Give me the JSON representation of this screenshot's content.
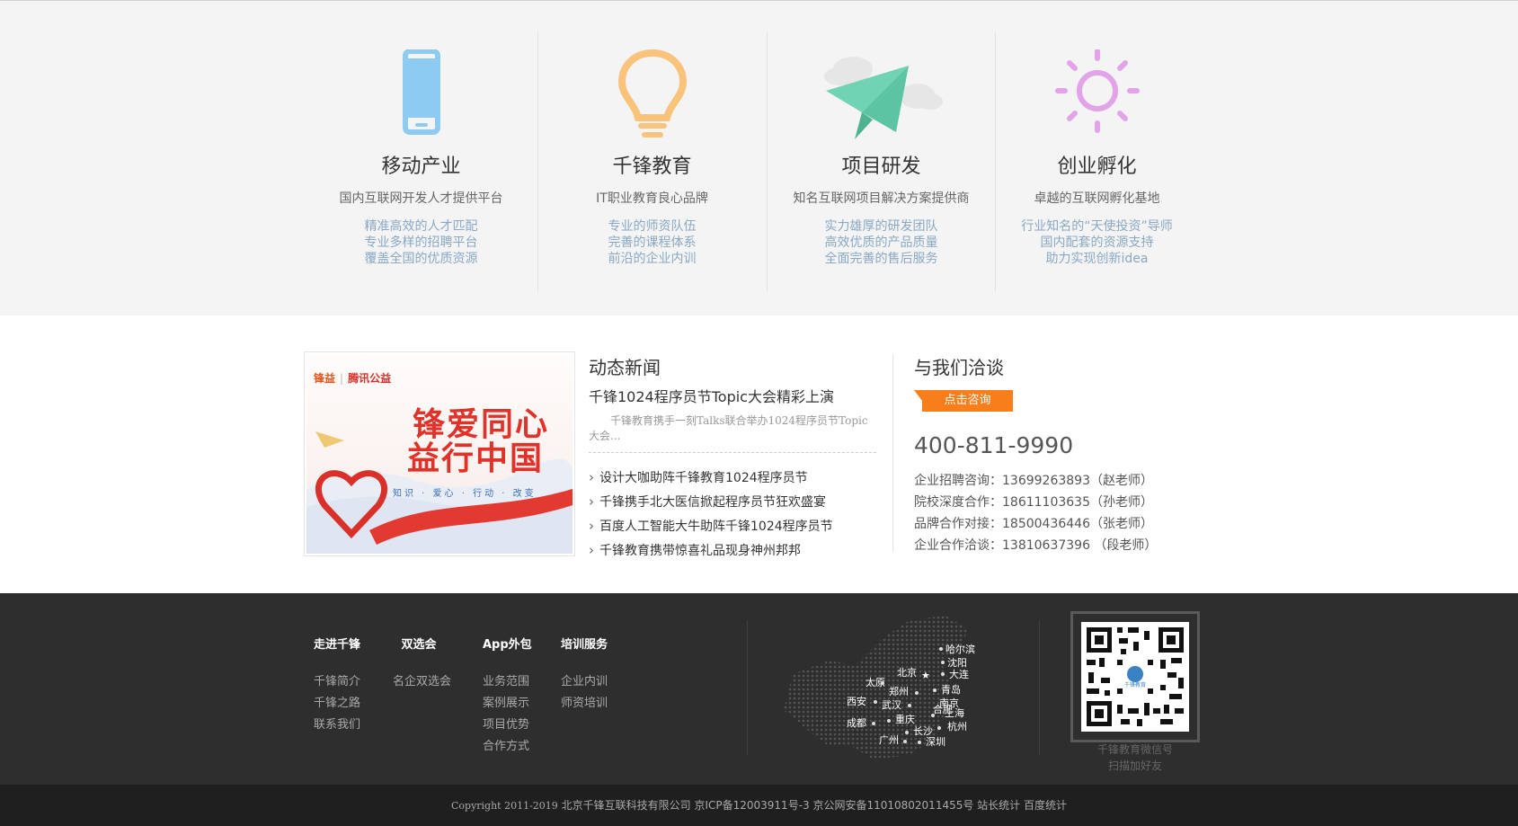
{
  "features": [
    {
      "icon": "phone-icon",
      "title": "移动产业",
      "subtitle": "国内互联网开发人才提供平台",
      "points": [
        "精准高效的人才匹配",
        "专业多样的招聘平台",
        "覆盖全国的优质资源"
      ]
    },
    {
      "icon": "lightbulb-icon",
      "title": "千锋教育",
      "subtitle": "IT职业教育良心品牌",
      "points": [
        "专业的师资队伍",
        "完善的课程体系",
        "前沿的企业内训"
      ]
    },
    {
      "icon": "paper-plane-icon",
      "title": "项目研发",
      "subtitle": "知名互联网项目解决方案提供商",
      "points": [
        "实力雄厚的研发团队",
        "高效优质的产品质量",
        "全面完善的售后服务"
      ]
    },
    {
      "icon": "sun-icon",
      "title": "创业孵化",
      "subtitle": "卓越的互联网孵化基地",
      "points": [
        "行业知名的“天使投资”导师",
        "国内配套的资源支持",
        "助力实现创新idea"
      ]
    }
  ],
  "colors": {
    "phone": "#8ecbf3",
    "bulb": "#f9c37c",
    "plane": "#6fd3b4",
    "sun": "#e2a3e8",
    "accent": "#f77e1a",
    "footer_bg": "#2e2e2e"
  },
  "promo": {
    "logo_left": "锋益",
    "logo_right": "腾讯公益",
    "line1": "锋爱同心",
    "line2": "益行中国",
    "tags": "知识 · 爱心 · 行动 · 改变"
  },
  "news": {
    "title": "动态新闻",
    "headline": "千锋1024程序员节Topic大会精彩上演",
    "summary": "千锋教育携手一刻Talks联合举办1024程序员节Topic大会...",
    "items": [
      "设计大咖助阵千锋教育1024程序员节",
      "千锋携手北大医信掀起程序员节狂欢盛宴",
      "百度人工智能大牛助阵千锋1024程序员节",
      "千锋教育携带惊喜礼品现身神州邦邦"
    ]
  },
  "contact": {
    "title": "与我们洽谈",
    "button": "点击咨询",
    "phone": "400-811-9990",
    "lines": [
      "企业招聘咨询：13699263893（赵老师）",
      "院校深度合作：18611103635（孙老师）",
      "品牌合作对接：18500436446（张老师）",
      "企业合作洽谈：13810637396 （段老师）"
    ]
  },
  "footer": {
    "columns": [
      {
        "head": "走进千锋",
        "links": [
          "千锋简介",
          "千锋之路",
          "联系我们"
        ]
      },
      {
        "head": "双选会",
        "links": [
          "名企双选会"
        ]
      },
      {
        "head": "App外包",
        "links": [
          "业务范围",
          "案例展示",
          "项目优势",
          "合作方式"
        ]
      },
      {
        "head": "培训服务",
        "links": [
          "企业内训",
          "师资培训"
        ]
      }
    ],
    "cities": [
      "哈尔滨",
      "沈阳",
      "大连",
      "北京",
      "太原",
      "郑州",
      "青岛",
      "西安",
      "武汉",
      "南京",
      "合肥",
      "上海",
      "成都",
      "重庆",
      "长沙",
      "杭州",
      "广州",
      "深圳"
    ],
    "qr_caption1": "千锋教育微信号",
    "qr_caption2": "扫描加好友",
    "qr_logo": "千锋教育",
    "copyright_prefix": "Copyright 2011-2019",
    "copyright_rest": "北京千锋互联科技有限公司 京ICP备12003911号-3 京公网安备11010802011455号 站长统计 百度统计"
  }
}
